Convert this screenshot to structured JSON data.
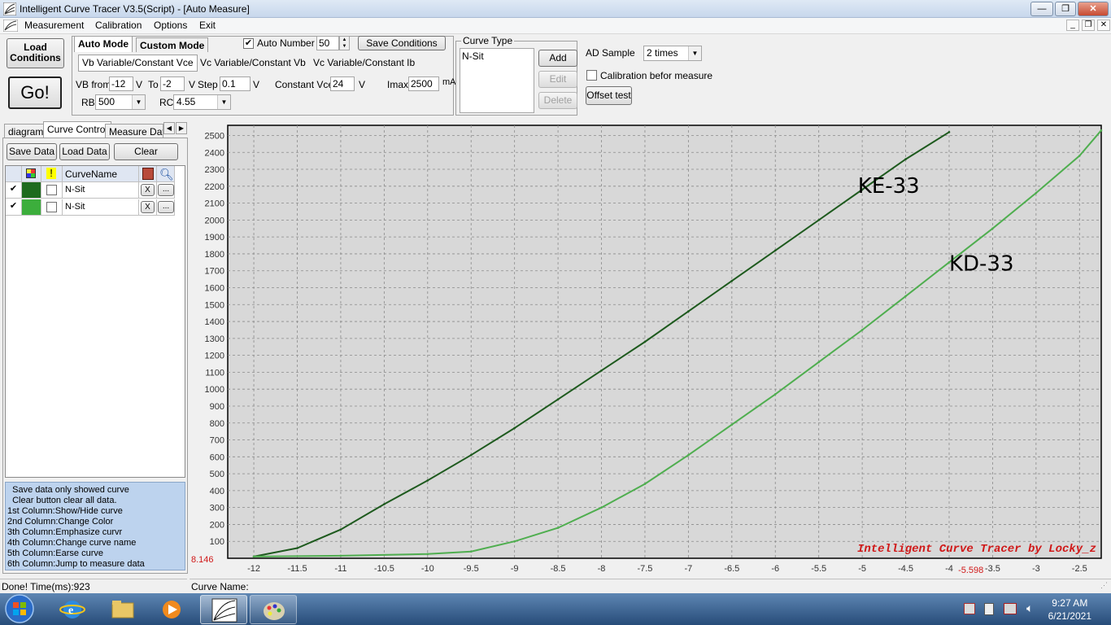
{
  "window": {
    "title": "Intelligent Curve Tracer V3.5(Script) - [Auto Measure]"
  },
  "menu": [
    "Measurement",
    "Calibration",
    "Options",
    "Exit"
  ],
  "left_buttons": {
    "load": "Load\nConditions",
    "go": "Go!"
  },
  "mode_tabs": {
    "auto": "Auto Mode",
    "custom": "Custom Mode"
  },
  "sub_tabs": [
    "Vb Variable/Constant Vce",
    "Vc Variable/Constant Vb",
    "Vc Variable/Constant Ib"
  ],
  "auto_number": {
    "label": "Auto Number",
    "value": "50",
    "checked": true
  },
  "save_conditions": "Save Conditions",
  "params": {
    "vb_from_label": "VB from",
    "vb_from": "-12",
    "v1": "V",
    "to_label": "To",
    "to": "-2",
    "v2": "V",
    "step_label": "Step",
    "step": "0.1",
    "v3": "V",
    "const_vce_label": "Constant Vce",
    "const_vce": "24",
    "v4": "V",
    "imax_label": "Imax",
    "imax": "2500",
    "ma": "mA",
    "rb_label": "RB",
    "rb": "500",
    "rc_label": "RC",
    "rc": "4.55"
  },
  "curve_type": {
    "label": "Curve Type",
    "items": [
      "N-Sit"
    ],
    "add": "Add",
    "edit": "Edit",
    "delete": "Delete"
  },
  "ad_sample": {
    "label": "AD Sample",
    "value": "2 times"
  },
  "calibration": {
    "label": "Calibration befor measure",
    "checked": false
  },
  "offset_test": "Offset test",
  "side_tabs": [
    "diagram",
    "Curve Control",
    "Measure Data"
  ],
  "side_buttons": {
    "save": "Save Data",
    "load": "Load Data",
    "clear": "Clear"
  },
  "curve_table": {
    "header_name": "CurveName",
    "rows": [
      {
        "checked": true,
        "color": "#1e6b1e",
        "emph": false,
        "name": "N-Sit",
        "x": "X",
        "more": "..."
      },
      {
        "checked": true,
        "color": "#3cae3c",
        "emph": false,
        "name": "N-Sit",
        "x": "X",
        "more": "..."
      }
    ]
  },
  "help_lines": [
    "  Save data only showed curve",
    "  Clear button clear all data.",
    "1st Column:Show/Hide curve",
    "2nd Column:Change Color",
    "3th Column:Emphasize curvr",
    "4th Column:Change curve name",
    "5th Column:Earse curve",
    "6th Column:Jump to measure data"
  ],
  "chart_data": {
    "type": "line",
    "xlim": [
      -12.3,
      -2.25
    ],
    "ylim": [
      0,
      2560
    ],
    "grid": true,
    "x_ticks": [
      -12,
      -11.5,
      -11,
      -10.5,
      -10,
      -9.5,
      -9,
      -8.5,
      -8,
      -7.5,
      -7,
      -6.5,
      -6,
      -5.5,
      -5,
      -4.5,
      -4,
      -3.5,
      -3,
      -2.5
    ],
    "y_ticks": [
      100,
      200,
      300,
      400,
      500,
      600,
      700,
      800,
      900,
      1000,
      1100,
      1200,
      1300,
      1400,
      1500,
      1600,
      1700,
      1800,
      1900,
      2000,
      2100,
      2200,
      2300,
      2400,
      2500
    ],
    "series": [
      {
        "color": "#1e5a1e",
        "x": [
          -12,
          -11.5,
          -11,
          -10.5,
          -10,
          -9.5,
          -9,
          -8.5,
          -8,
          -7.5,
          -7,
          -6.5,
          -6,
          -5.5,
          -5,
          -4.5,
          -4
        ],
        "y": [
          10,
          60,
          170,
          320,
          460,
          610,
          770,
          940,
          1110,
          1280,
          1460,
          1640,
          1820,
          2000,
          2180,
          2360,
          2520
        ]
      },
      {
        "color": "#4fae4f",
        "x": [
          -12,
          -11,
          -10,
          -9.5,
          -9,
          -8.5,
          -8,
          -7.5,
          -7,
          -6.5,
          -6,
          -5.5,
          -5,
          -4.5,
          -4,
          -3.5,
          -3,
          -2.5,
          -2.25
        ],
        "y": [
          10,
          15,
          25,
          40,
          100,
          180,
          300,
          440,
          610,
          790,
          970,
          1160,
          1350,
          1550,
          1750,
          1950,
          2160,
          2380,
          2530
        ]
      }
    ],
    "annotations": [
      "KE-33",
      "KD-33"
    ],
    "watermark": "Intelligent Curve Tracer by Locky_z",
    "readout_y": "8.146",
    "readout_x": "-5.598"
  },
  "status": {
    "left": "Done!  Time(ms):923",
    "right": "Curve Name:"
  },
  "clock": {
    "time": "9:27 AM",
    "date": "6/21/2021"
  },
  "colors": {
    "plot_bg": "#d8d8d8",
    "grid": "#8a8a8a",
    "readout": "#d01818"
  }
}
